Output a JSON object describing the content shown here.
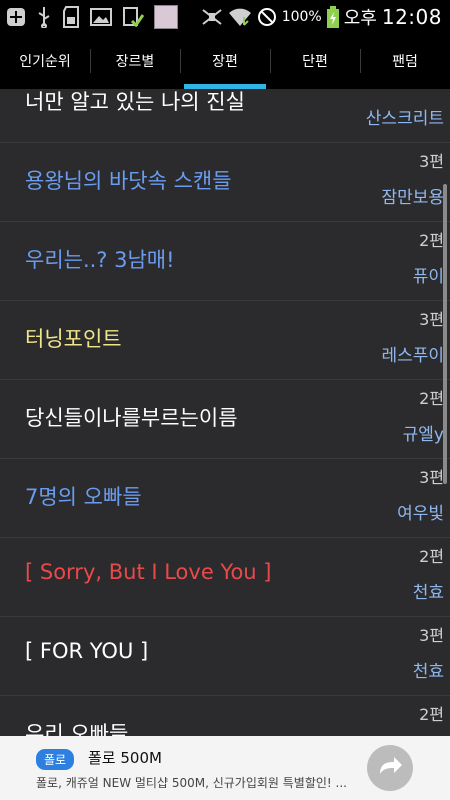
{
  "status": {
    "battery": "100%",
    "ampm": "오후",
    "time": "12:08",
    "icons": [
      "add-icon",
      "usb-icon",
      "sd-card-icon",
      "image-icon",
      "download-check-icon",
      "mute-icon",
      "wifi-icon",
      "blocked-icon",
      "battery-icon"
    ]
  },
  "tabs": [
    {
      "label": "인기순위"
    },
    {
      "label": "장르별"
    },
    {
      "label": "장편",
      "active": true
    },
    {
      "label": "단편"
    },
    {
      "label": "팬덤"
    }
  ],
  "list": [
    {
      "title": "너만 알고 있는 나의 진실",
      "count": "",
      "author": "산스크리트",
      "color": "white"
    },
    {
      "title": "용왕님의 바닷속 스캔들",
      "count": "3편",
      "author": "잠만보용",
      "color": "blue"
    },
    {
      "title": "우리는..? 3남매!",
      "count": "2편",
      "author": "퓨이",
      "color": "blue"
    },
    {
      "title": "터닝포인트",
      "count": "3편",
      "author": "레스푸이",
      "color": "yellow"
    },
    {
      "title": "당신들이나를부르는이름",
      "count": "2편",
      "author": "규엘y",
      "color": "white"
    },
    {
      "title": "7명의 오빠들",
      "count": "3편",
      "author": "여우빛",
      "color": "blue"
    },
    {
      "title": "[ Sorry, But I Love You ]",
      "count": "2편",
      "author": "천효",
      "color": "red"
    },
    {
      "title": "[ FOR YOU ]",
      "count": "3편",
      "author": "천효",
      "color": "white-bold"
    },
    {
      "title": "우리 오빠들",
      "count": "2편",
      "author": "",
      "color": "white"
    }
  ],
  "ad": {
    "badge": "폴로",
    "title": "폴로 500M",
    "description": "폴로, 캐쥬얼 NEW 멀티샵 500M, 신규가입회원 특별할인! ..."
  }
}
